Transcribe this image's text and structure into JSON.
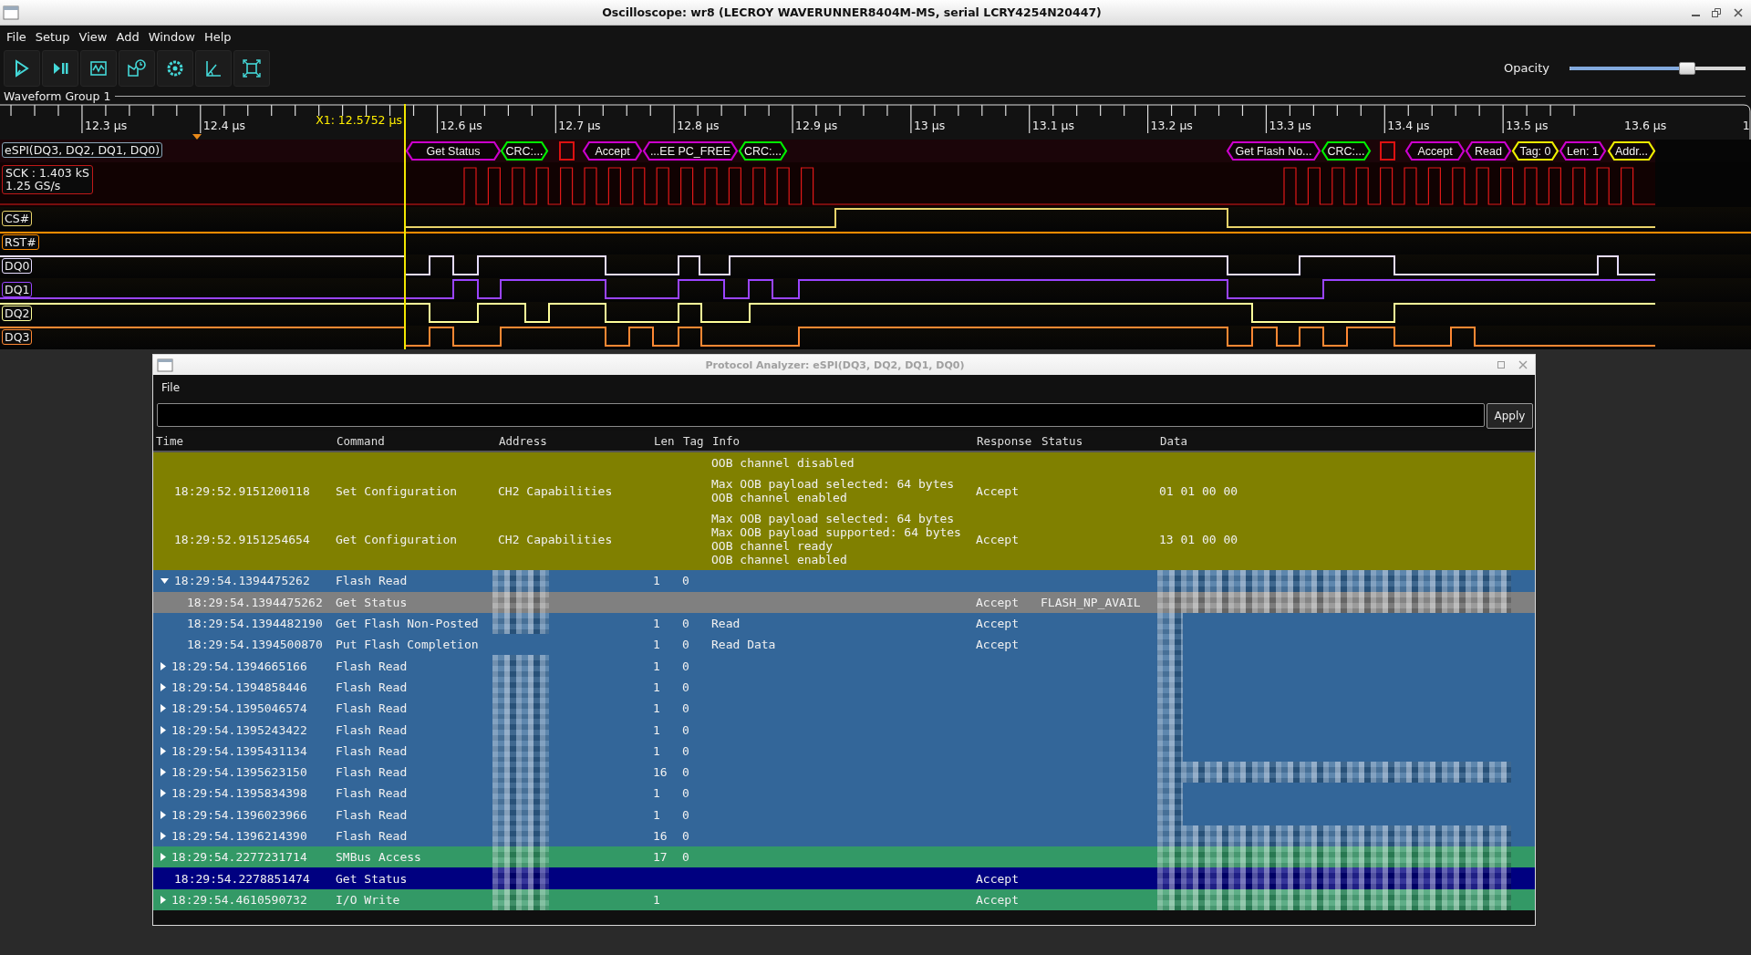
{
  "window": {
    "title": "Oscilloscope: wr8 (LECROY WAVERUNNER8404M-MS, serial LCRY4254N20447)"
  },
  "menu": [
    "File",
    "Setup",
    "View",
    "Add",
    "Window",
    "Help"
  ],
  "opacity": {
    "label": "Opacity",
    "level": 0.67
  },
  "waveform_group": {
    "title": "Waveform Group 1",
    "ruler": [
      "12.3 µs",
      "12.4 µs",
      "12.6 µs",
      "12.7 µs",
      "12.8 µs",
      "12.9 µs",
      "13 µs",
      "13.1 µs",
      "13.2 µs",
      "13.3 µs",
      "13.4 µs",
      "13.5 µs",
      "13.6 µs",
      "1"
    ],
    "cursor": {
      "label": "X1: 12.5752 µs"
    },
    "decoder": {
      "label": "eSPI(DQ3, DQ2, DQ1, DQ0)",
      "packets": [
        {
          "kind": "field",
          "label": "Get Status",
          "color": "#cc00cc"
        },
        {
          "kind": "field",
          "label": "CRC:...",
          "color": "#00ee00"
        },
        {
          "kind": "marker",
          "color": "#dd1111"
        },
        {
          "kind": "field",
          "label": "Accept",
          "color": "#cc00cc"
        },
        {
          "kind": "field",
          "label": "...EE PC_FREE",
          "color": "#cc00cc"
        },
        {
          "kind": "field",
          "label": "CRC:...",
          "color": "#00ee00"
        },
        {
          "kind": "field",
          "label": "Get Flash No...",
          "color": "#cc00cc"
        },
        {
          "kind": "field",
          "label": "CRC:...",
          "color": "#00ee00"
        },
        {
          "kind": "marker",
          "color": "#dd1111"
        },
        {
          "kind": "field",
          "label": "Accept",
          "color": "#cc00cc"
        },
        {
          "kind": "field",
          "label": "Read",
          "color": "#cc00cc"
        },
        {
          "kind": "field",
          "label": "Tag: 0",
          "color": "#eeee00"
        },
        {
          "kind": "field",
          "label": "Len: 1",
          "color": "#cc00cc"
        },
        {
          "kind": "field",
          "label": "Addr...",
          "color": "#eeee00"
        }
      ]
    },
    "clock": {
      "lines": [
        "SCK : 1.403 kS",
        "1.25 GS/s"
      ]
    },
    "channels": [
      {
        "name": "CS#",
        "color": "#e8d36a"
      },
      {
        "name": "RST#",
        "color": "#ff8c00"
      },
      {
        "name": "DQ0",
        "color": "#e6dcff"
      },
      {
        "name": "DQ1",
        "color": "#9a44ff"
      },
      {
        "name": "DQ2",
        "color": "#ffff99"
      },
      {
        "name": "DQ3",
        "color": "#ff8833"
      }
    ]
  },
  "analyzer": {
    "title": "Protocol Analyzer: eSPI(DQ3, DQ2, DQ1, DQ0)",
    "menu": [
      "File"
    ],
    "apply": "Apply",
    "columns": [
      "Time",
      "Command",
      "Address",
      "Len",
      "Tag",
      "Info",
      "Response",
      "Status",
      "Data"
    ],
    "rows": [
      {
        "info": [
          "OOB channel disabled"
        ],
        "color": "#808000",
        "selected": false,
        "address_redacted": false,
        "data_redacted": false
      },
      {
        "time": "18:29:52.9151200118",
        "command": "Set Configuration",
        "address": "CH2 Capabilities",
        "info": [
          "Max OOB payload selected: 64 bytes",
          "OOB channel enabled"
        ],
        "response": "Accept",
        "data": "01 01 00 00",
        "color": "#808000",
        "selected": false,
        "address_redacted": false,
        "data_redacted": false
      },
      {
        "time": "18:29:52.9151254654",
        "command": "Get Configuration",
        "address": "CH2 Capabilities",
        "info": [
          "Max OOB payload selected: 64 bytes",
          "Max OOB payload supported: 64 bytes",
          "OOB channel ready",
          "OOB channel enabled"
        ],
        "response": "Accept",
        "data": "13 01 00 00",
        "color": "#808000",
        "selected": false,
        "address_redacted": false,
        "data_redacted": false
      },
      {
        "time": "18:29:54.1394475262",
        "command": "Flash Read",
        "len": "1",
        "tag": "0",
        "color": "#336699",
        "selected": false,
        "expanded": true,
        "address_redacted": true,
        "data_redacted": true,
        "data_redacted_wide": true,
        "children": [
          {
            "time": "18:29:54.1394475262",
            "command": "Get Status",
            "response": "Accept",
            "status": "FLASH_NP_AVAIL",
            "color": "#808080",
            "selected": false,
            "address_redacted": true,
            "data_redacted": true,
            "data_redacted_wide": true
          },
          {
            "time": "18:29:54.1394482190",
            "command": "Get Flash Non-Posted",
            "len": "1",
            "tag": "0",
            "info": [
              "Read"
            ],
            "response": "Accept",
            "color": "#336699",
            "selected": false,
            "address_redacted": true,
            "data_redacted": true,
            "data_redacted_wide": false
          },
          {
            "time": "18:29:54.1394500870",
            "command": "Put Flash Completion",
            "len": "1",
            "tag": "0",
            "info": [
              "Read Data"
            ],
            "response": "Accept",
            "color": "#336699",
            "selected": false,
            "address_redacted": false,
            "data_redacted": true,
            "data_redacted_wide": false
          }
        ]
      },
      {
        "time": "18:29:54.1394665166",
        "command": "Flash Read",
        "len": "1",
        "tag": "0",
        "color": "#336699",
        "selected": false,
        "expanded": false,
        "address_redacted": true,
        "data_redacted": true,
        "data_redacted_wide": false
      },
      {
        "time": "18:29:54.1394858446",
        "command": "Flash Read",
        "len": "1",
        "tag": "0",
        "color": "#336699",
        "selected": false,
        "expanded": false,
        "address_redacted": true,
        "data_redacted": true,
        "data_redacted_wide": false
      },
      {
        "time": "18:29:54.1395046574",
        "command": "Flash Read",
        "len": "1",
        "tag": "0",
        "color": "#336699",
        "selected": false,
        "expanded": false,
        "address_redacted": true,
        "data_redacted": true,
        "data_redacted_wide": false
      },
      {
        "time": "18:29:54.1395243422",
        "command": "Flash Read",
        "len": "1",
        "tag": "0",
        "color": "#336699",
        "selected": false,
        "expanded": false,
        "address_redacted": true,
        "data_redacted": true,
        "data_redacted_wide": false
      },
      {
        "time": "18:29:54.1395431134",
        "command": "Flash Read",
        "len": "1",
        "tag": "0",
        "color": "#336699",
        "selected": false,
        "expanded": false,
        "address_redacted": true,
        "data_redacted": true,
        "data_redacted_wide": false
      },
      {
        "time": "18:29:54.1395623150",
        "command": "Flash Read",
        "len": "16",
        "tag": "0",
        "color": "#336699",
        "selected": false,
        "expanded": false,
        "address_redacted": true,
        "data_redacted": true,
        "data_redacted_wide": true
      },
      {
        "time": "18:29:54.1395834398",
        "command": "Flash Read",
        "len": "1",
        "tag": "0",
        "color": "#336699",
        "selected": false,
        "expanded": false,
        "address_redacted": true,
        "data_redacted": true,
        "data_redacted_wide": false
      },
      {
        "time": "18:29:54.1396023966",
        "command": "Flash Read",
        "len": "1",
        "tag": "0",
        "color": "#336699",
        "selected": false,
        "expanded": false,
        "address_redacted": true,
        "data_redacted": true,
        "data_redacted_wide": false
      },
      {
        "time": "18:29:54.1396214390",
        "command": "Flash Read",
        "len": "16",
        "tag": "0",
        "color": "#336699",
        "selected": false,
        "expanded": false,
        "address_redacted": true,
        "data_redacted": true,
        "data_redacted_wide": true
      },
      {
        "time": "18:29:54.2277231714",
        "command": "SMBus Access",
        "len": "17",
        "tag": "0",
        "color": "#339966",
        "selected": false,
        "expanded": false,
        "address_redacted": true,
        "data_redacted": true,
        "data_redacted_wide": true
      },
      {
        "time": "18:29:54.2278851474",
        "command": "Get Status",
        "response": "Accept",
        "selected": true,
        "address_redacted": true,
        "data_redacted": true,
        "data_redacted_wide": true
      },
      {
        "time": "18:29:54.4610590732",
        "command": "I/O Write",
        "len": "1",
        "response": "Accept",
        "color": "#339966",
        "selected": false,
        "expanded": false,
        "address_redacted": true,
        "data_redacted": true,
        "data_redacted_wide": true
      }
    ]
  }
}
